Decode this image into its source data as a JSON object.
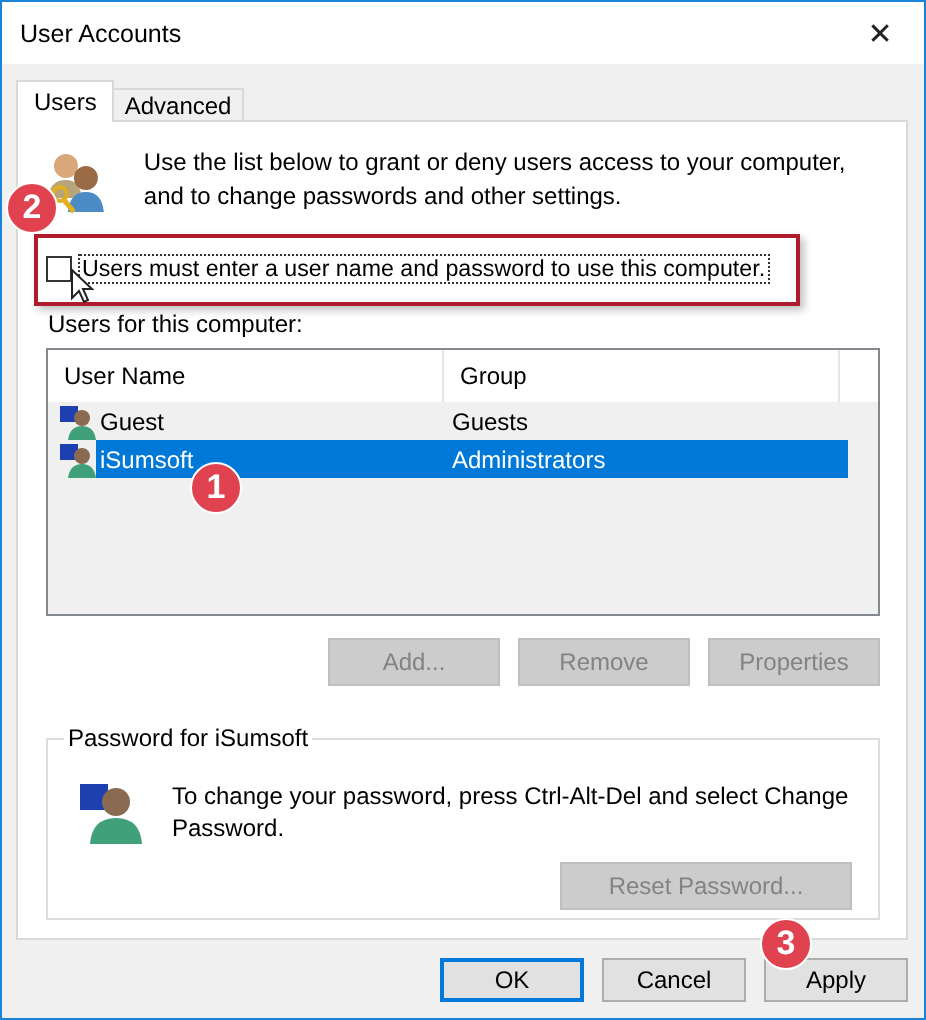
{
  "window": {
    "title": "User Accounts",
    "close": "✕"
  },
  "tabs": [
    {
      "label": "Users",
      "selected": true
    },
    {
      "label": "Advanced",
      "selected": false
    }
  ],
  "intro": "Use the list below to grant or deny users access to your computer, and to change passwords and other settings.",
  "require_password": {
    "label": "Users must enter a user name and password to use this computer.",
    "checked": false
  },
  "users_list": {
    "label": "Users for this computer:",
    "columns": [
      "User Name",
      "Group"
    ],
    "rows": [
      {
        "name": "Guest",
        "group": "Guests",
        "selected": false
      },
      {
        "name": "iSumsoft",
        "group": "Administrators",
        "selected": true
      }
    ]
  },
  "list_buttons": [
    {
      "label": "Add...",
      "disabled": true
    },
    {
      "label": "Remove",
      "disabled": true
    },
    {
      "label": "Properties",
      "disabled": true
    }
  ],
  "password_group": {
    "title": "Password for iSumsoft",
    "text": "To change your password, press Ctrl-Alt-Del and select Change Password.",
    "button": {
      "label": "Reset Password...",
      "disabled": true
    }
  },
  "dialog_buttons": [
    {
      "label": "OK",
      "default": true
    },
    {
      "label": "Cancel",
      "default": false
    },
    {
      "label": "Apply",
      "default": false
    }
  ],
  "annotations": [
    {
      "label": "2"
    },
    {
      "label": "1"
    },
    {
      "label": "3"
    }
  ]
}
